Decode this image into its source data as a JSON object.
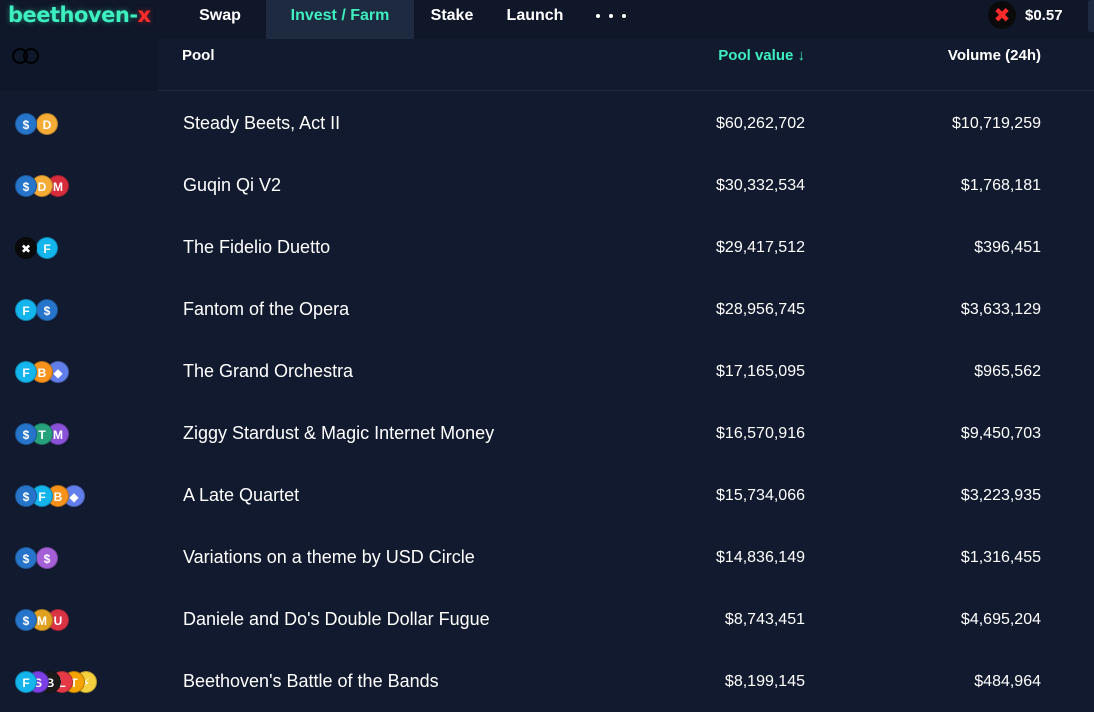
{
  "nav": {
    "logo_main": "beethoven-",
    "logo_x": "x",
    "items": [
      {
        "label": "Swap",
        "active": false
      },
      {
        "label": "Invest / Farm",
        "active": true
      },
      {
        "label": "Stake",
        "active": false
      },
      {
        "label": "Launch",
        "active": false
      }
    ],
    "token_price": "$0.57"
  },
  "colors": {
    "accent": "#3df0c0",
    "background": "#111a2e",
    "brand_red": "#ff2a2a"
  },
  "table": {
    "headers": {
      "pool": "Pool",
      "pool_value": "Pool value ↓",
      "volume": "Volume (24h)"
    },
    "rows": [
      {
        "name": "Steady Beets, Act II",
        "value": "$60,262,702",
        "volume": "$10,719,259",
        "tokens": [
          {
            "icon": "usdc-icon",
            "glyph": "$",
            "color": "#2775ca"
          },
          {
            "icon": "dai-icon",
            "glyph": "D",
            "color": "#f5ac37"
          }
        ]
      },
      {
        "name": "Guqin Qi V2",
        "value": "$30,332,534",
        "volume": "$1,768,181",
        "tokens": [
          {
            "icon": "usdc-icon",
            "glyph": "$",
            "color": "#2775ca"
          },
          {
            "icon": "dai-icon",
            "glyph": "D",
            "color": "#f5ac37"
          },
          {
            "icon": "mim-icon",
            "glyph": "M",
            "color": "#d62c3b"
          }
        ]
      },
      {
        "name": "The Fidelio Duetto",
        "value": "$29,417,512",
        "volume": "$396,451",
        "tokens": [
          {
            "icon": "beets-icon",
            "glyph": "✖",
            "color": "#0a0a0a"
          },
          {
            "icon": "ftm-icon",
            "glyph": "F",
            "color": "#13b5ec"
          }
        ]
      },
      {
        "name": "Fantom of the Opera",
        "value": "$28,956,745",
        "volume": "$3,633,129",
        "tokens": [
          {
            "icon": "ftm-icon",
            "glyph": "F",
            "color": "#13b5ec"
          },
          {
            "icon": "usdc-icon",
            "glyph": "$",
            "color": "#2775ca"
          }
        ]
      },
      {
        "name": "The Grand Orchestra",
        "value": "$17,165,095",
        "volume": "$965,562",
        "tokens": [
          {
            "icon": "ftm-icon",
            "glyph": "F",
            "color": "#13b5ec"
          },
          {
            "icon": "btc-icon",
            "glyph": "B",
            "color": "#f7931a"
          },
          {
            "icon": "eth-icon",
            "glyph": "◆",
            "color": "#627eea"
          }
        ]
      },
      {
        "name": "Ziggy Stardust & Magic Internet Money",
        "value": "$16,570,916",
        "volume": "$9,450,703",
        "tokens": [
          {
            "icon": "usdc-icon",
            "glyph": "$",
            "color": "#2775ca"
          },
          {
            "icon": "usdt-icon",
            "glyph": "T",
            "color": "#26a17b"
          },
          {
            "icon": "mim-icon",
            "glyph": "M",
            "color": "#8a52d8"
          }
        ]
      },
      {
        "name": "A Late Quartet",
        "value": "$15,734,066",
        "volume": "$3,223,935",
        "tokens": [
          {
            "icon": "usdc-icon",
            "glyph": "$",
            "color": "#2775ca"
          },
          {
            "icon": "ftm-icon",
            "glyph": "F",
            "color": "#13b5ec"
          },
          {
            "icon": "btc-icon",
            "glyph": "B",
            "color": "#f7931a"
          },
          {
            "icon": "eth-icon",
            "glyph": "◆",
            "color": "#627eea"
          }
        ]
      },
      {
        "name": "Variations on a theme by USD Circle",
        "value": "$14,836,149",
        "volume": "$1,316,455",
        "tokens": [
          {
            "icon": "usdc-icon",
            "glyph": "$",
            "color": "#2775ca"
          },
          {
            "icon": "usd-circle-icon",
            "glyph": "$",
            "color": "#a560d8"
          }
        ]
      },
      {
        "name": "Daniele and Do's Double Dollar Fugue",
        "value": "$8,743,451",
        "volume": "$4,695,204",
        "tokens": [
          {
            "icon": "usdc-icon",
            "glyph": "$",
            "color": "#2775ca"
          },
          {
            "icon": "mim-icon",
            "glyph": "M",
            "color": "#e0a020"
          },
          {
            "icon": "us-flag-icon",
            "glyph": "U",
            "color": "#d93344"
          }
        ]
      },
      {
        "name": "Beethoven's Battle of the Bands",
        "value": "$8,199,145",
        "volume": "$484,964",
        "tokens": [
          {
            "icon": "ftm-icon",
            "glyph": "F",
            "color": "#13b5ec"
          },
          {
            "icon": "spirit-icon",
            "glyph": "S",
            "color": "#7b3fe4"
          },
          {
            "icon": "boo-icon",
            "glyph": "B",
            "color": "#1a1a1a"
          },
          {
            "icon": "lqdr-icon",
            "glyph": "L",
            "color": "#e63946"
          },
          {
            "icon": "tarot-icon",
            "glyph": "T",
            "color": "#f4a300"
          },
          {
            "icon": "bomb-icon",
            "glyph": "⚡",
            "color": "#f4d03f"
          }
        ]
      }
    ]
  }
}
